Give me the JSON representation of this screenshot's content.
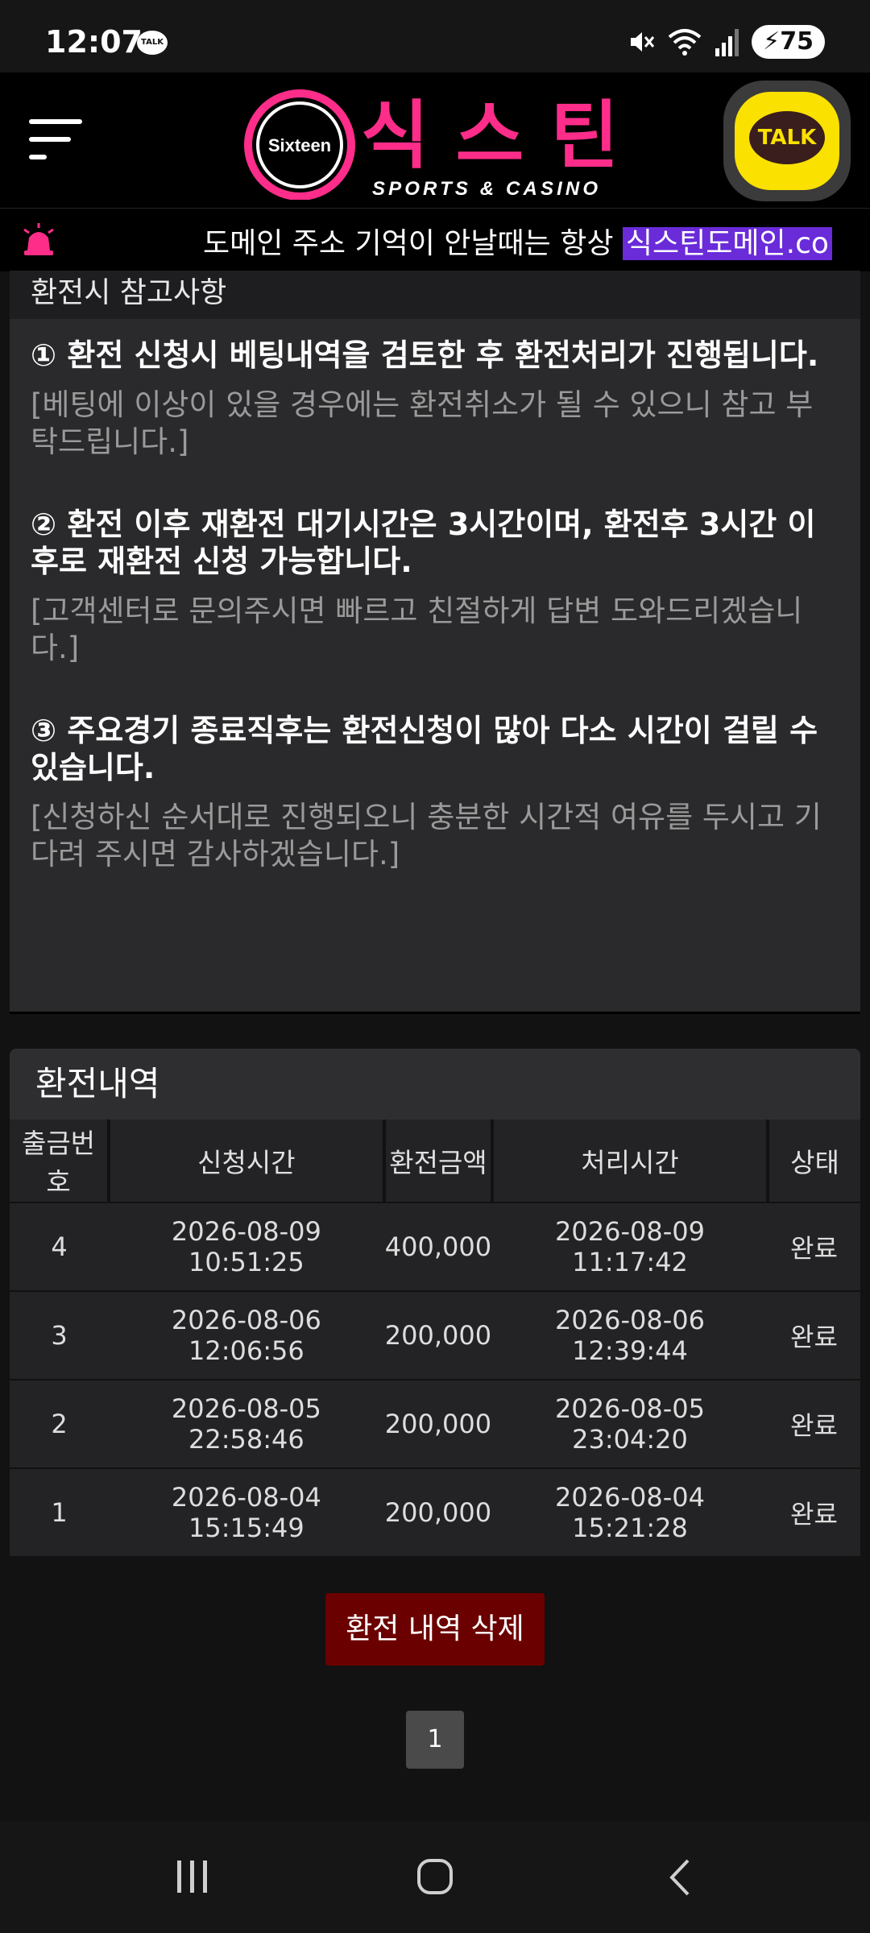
{
  "status_bar": {
    "time": "12:07",
    "talk_badge": "TALK",
    "battery": "75"
  },
  "header": {
    "logo_circle_text": "Sixteen",
    "logo_korean": "식스틴",
    "logo_sub": "SPORTS & CASINO",
    "kakao_label": "TALK"
  },
  "ticker": {
    "text": "도메인 주소 기억이 안날때는 항상 ",
    "link": "식스틴도메인.co"
  },
  "notice": {
    "header": "환전시 참고사항",
    "items": [
      {
        "title": "① 환전 신청시 베팅내역을 검토한 후 환전처리가 진행됩니다.",
        "sub": "[베팅에 이상이 있을 경우에는 환전취소가 될 수 있으니 참고 부탁드립니다.]"
      },
      {
        "title": "② 환전 이후 재환전 대기시간은 3시간이며, 환전후 3시간 이후로 재환전 신청 가능합니다.",
        "sub": "[고객센터로 문의주시면 빠르고 친절하게 답변 도와드리겠습니다.]"
      },
      {
        "title": "③ 주요경기 종료직후는 환전신청이 많아 다소 시간이 걸릴 수 있습니다.",
        "sub": "[신청하신 순서대로 진행되오니 충분한 시간적 여유를 두시고 기다려 주시면 감사하겠습니다.]"
      }
    ]
  },
  "history": {
    "title": "환전내역",
    "columns": [
      "출금번호",
      "신청시간",
      "환전금액",
      "처리시간",
      "상태"
    ],
    "rows": [
      [
        "4",
        "2026-08-09 10:51:25",
        "400,000",
        "2026-08-09 11:17:42",
        "완료"
      ],
      [
        "3",
        "2026-08-06 12:06:56",
        "200,000",
        "2026-08-06 12:39:44",
        "완료"
      ],
      [
        "2",
        "2026-08-05 22:58:46",
        "200,000",
        "2026-08-05 23:04:20",
        "완료"
      ],
      [
        "1",
        "2026-08-04 15:15:49",
        "200,000",
        "2026-08-04 15:21:28",
        "완료"
      ]
    ]
  },
  "actions": {
    "delete_label": "환전 내역 삭제"
  },
  "pagination": {
    "current_page": "1"
  },
  "colors": {
    "brand_pink": "#ff2d8a",
    "delete_button": "#6b0000",
    "ticker_link_bg": "#6a2bd9",
    "kakao_yellow": "#fae100"
  }
}
